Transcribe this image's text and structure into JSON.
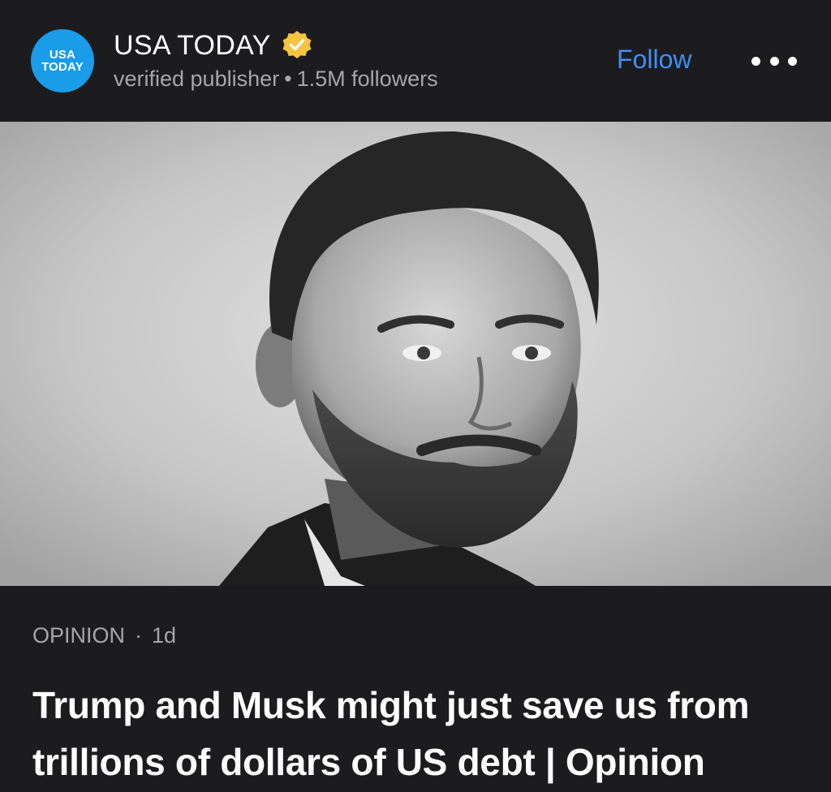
{
  "publisher": {
    "logo_line1": "USA",
    "logo_line2": "TODAY",
    "name": "USA TODAY",
    "status": "verified publisher",
    "separator": "•",
    "followers": "1.5M followers",
    "follow_label": "Follow",
    "verified_icon": "verified-badge-icon"
  },
  "article": {
    "section": "OPINION",
    "separator": "·",
    "age": "1d",
    "headline": "Trump and Musk might just save us from trillions of dollars of US debt | Opinion"
  },
  "colors": {
    "background": "#1c1c1e",
    "accent": "#3f8ef5",
    "logo": "#1a9ce8",
    "badge": "#f5c542",
    "secondary_text": "#a6a6ab"
  }
}
